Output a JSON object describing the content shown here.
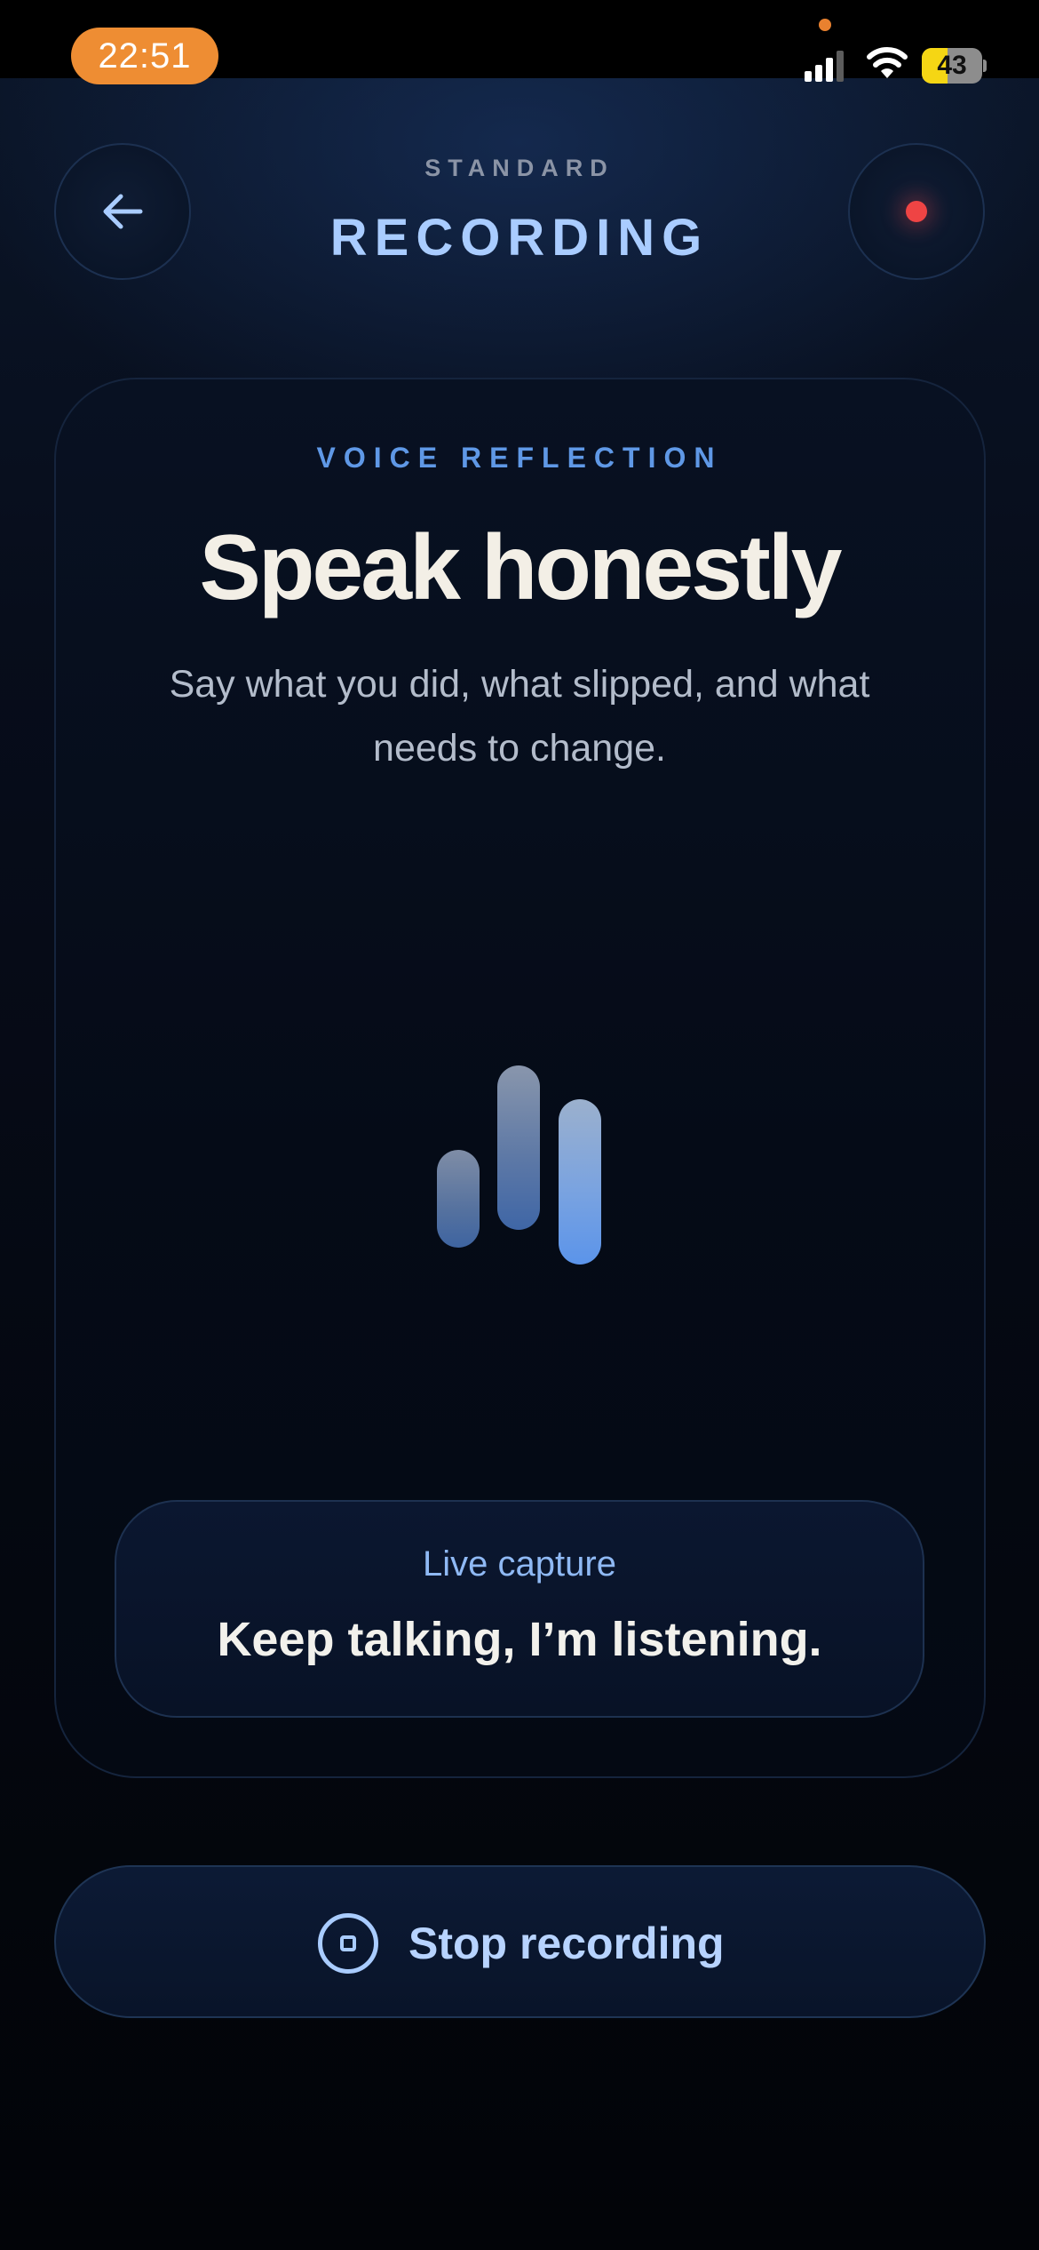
{
  "status_bar": {
    "time": "22:51",
    "battery_level": "43",
    "battery_fraction": 0.43,
    "icons": [
      "signal-icon",
      "wifi-icon",
      "battery-icon"
    ]
  },
  "header": {
    "eyebrow": "STANDARD",
    "title": "RECORDING",
    "back_icon": "arrow-left-icon",
    "record_icon": "record-dot-icon"
  },
  "card": {
    "eyebrow": "VOICE REFLECTION",
    "title": "Speak honestly",
    "subtitle": "Say what you did, what slipped, and what needs to change.",
    "waveform_icon": "audio-waveform-icon"
  },
  "live_capture": {
    "label": "Live capture",
    "text": "Keep talking, I’m listening."
  },
  "stop_button": {
    "label": "Stop recording",
    "icon": "stop-circle-icon"
  },
  "colors": {
    "accent": "#a9ccff",
    "eyebrow_blue": "#5f98e6",
    "recording_red": "#ef4444",
    "time_pill": "#ee8d33",
    "battery": "#f5d614",
    "background": "#04070f"
  }
}
